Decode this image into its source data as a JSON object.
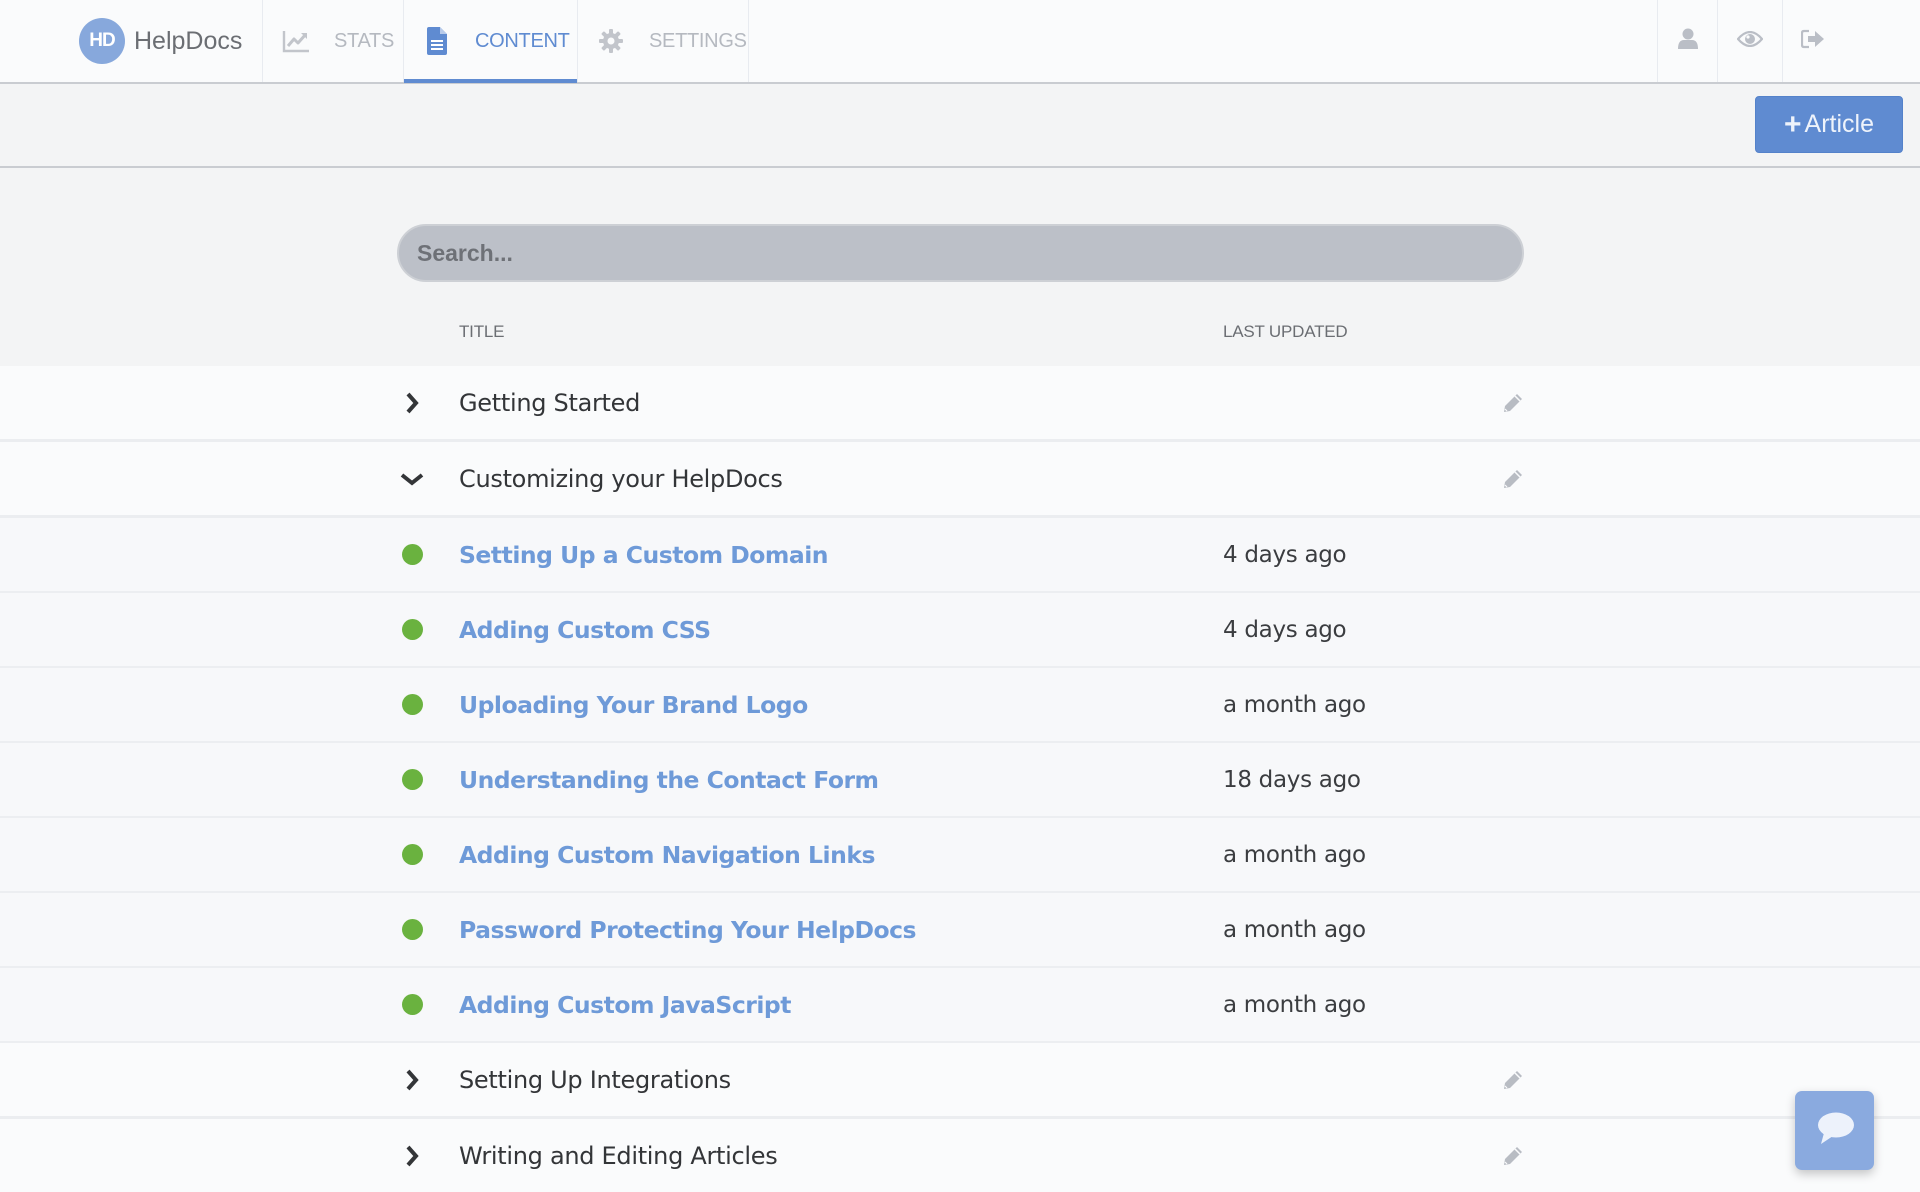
{
  "app": {
    "logo_mark": "HD",
    "logo_text": "HelpDocs"
  },
  "nav": {
    "tabs": [
      {
        "label": "STATS",
        "icon": "line-chart-icon",
        "active": false
      },
      {
        "label": "CONTENT",
        "icon": "document-icon",
        "active": true
      },
      {
        "label": "SETTINGS",
        "icon": "gear-icon",
        "active": false
      }
    ],
    "right_icons": [
      "user-icon",
      "eye-icon",
      "sign-out-icon"
    ]
  },
  "toolbar": {
    "add_article_plus": "+",
    "add_article_label": "Article"
  },
  "search": {
    "placeholder": "Search...",
    "value": ""
  },
  "table": {
    "columns": {
      "title": "TITLE",
      "last_updated": "LAST UPDATED"
    },
    "rows": [
      {
        "type": "category",
        "title": "Getting Started",
        "expanded": false
      },
      {
        "type": "category",
        "title": "Customizing your HelpDocs",
        "expanded": true
      },
      {
        "type": "article",
        "title": "Setting Up a Custom Domain",
        "updated": "4 days ago",
        "status": "published"
      },
      {
        "type": "article",
        "title": "Adding Custom CSS",
        "updated": "4 days ago",
        "status": "published"
      },
      {
        "type": "article",
        "title": "Uploading Your Brand Logo",
        "updated": "a month ago",
        "status": "published"
      },
      {
        "type": "article",
        "title": "Understanding the Contact Form",
        "updated": "18 days ago",
        "status": "published"
      },
      {
        "type": "article",
        "title": "Adding Custom Navigation Links",
        "updated": "a month ago",
        "status": "published"
      },
      {
        "type": "article",
        "title": "Password Protecting Your HelpDocs",
        "updated": "a month ago",
        "status": "published"
      },
      {
        "type": "article",
        "title": "Adding Custom JavaScript",
        "updated": "a month ago",
        "status": "published"
      },
      {
        "type": "category",
        "title": "Setting Up Integrations",
        "expanded": false
      },
      {
        "type": "category",
        "title": "Writing and Editing Articles",
        "expanded": false
      }
    ]
  },
  "chat": {
    "icon": "chat-bubble-icon"
  },
  "colors": {
    "accent": "#5f8bd1",
    "article_link": "#6e9ad8",
    "status_published": "#6ab23f",
    "icon_muted": "#b8bcc3",
    "chat_button": "#8aaadf"
  }
}
